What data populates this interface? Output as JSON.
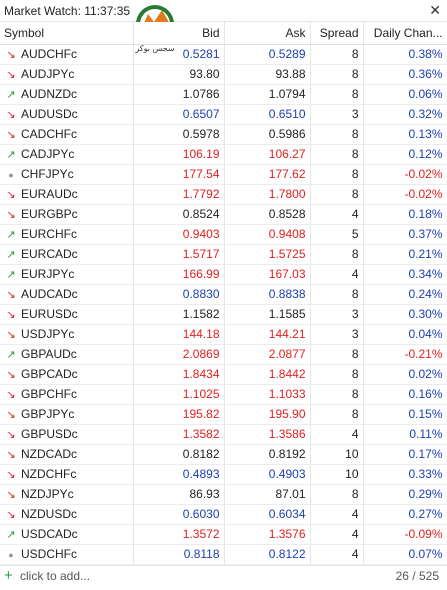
{
  "window": {
    "title": "Market Watch: 11:37:35",
    "close_glyph": "✕"
  },
  "logo": {
    "text": "سجس بوکر",
    "icon": "fox-logo-icon"
  },
  "columns": {
    "symbol": "Symbol",
    "bid": "Bid",
    "ask": "Ask",
    "spread": "Spread",
    "change": "Daily Chan..."
  },
  "colors": {
    "down": "#d43030",
    "up": "#2a9a3a",
    "bid_blue": "#1a3fb0",
    "price_red": "#e02020"
  },
  "rows": [
    {
      "symbol": "AUDCHFc",
      "dir": "down",
      "bid": "0.5281",
      "ask": "0.5289",
      "price_color": "blue",
      "spread": "8",
      "change": "0.38%",
      "change_color": "blue"
    },
    {
      "symbol": "AUDJPYc",
      "dir": "down",
      "bid": "93.80",
      "ask": "93.88",
      "price_color": "black",
      "spread": "8",
      "change": "0.36%",
      "change_color": "blue"
    },
    {
      "symbol": "AUDNZDc",
      "dir": "up",
      "bid": "1.0786",
      "ask": "1.0794",
      "price_color": "black",
      "spread": "8",
      "change": "0.06%",
      "change_color": "blue"
    },
    {
      "symbol": "AUDUSDc",
      "dir": "down",
      "bid": "0.6507",
      "ask": "0.6510",
      "price_color": "blue",
      "spread": "3",
      "change": "0.32%",
      "change_color": "blue"
    },
    {
      "symbol": "CADCHFc",
      "dir": "down",
      "bid": "0.5978",
      "ask": "0.5986",
      "price_color": "black",
      "spread": "8",
      "change": "0.13%",
      "change_color": "blue"
    },
    {
      "symbol": "CADJPYc",
      "dir": "up",
      "bid": "106.19",
      "ask": "106.27",
      "price_color": "red",
      "spread": "8",
      "change": "0.12%",
      "change_color": "blue"
    },
    {
      "symbol": "CHFJPYc",
      "dir": "flat",
      "bid": "177.54",
      "ask": "177.62",
      "price_color": "red",
      "spread": "8",
      "change": "-0.02%",
      "change_color": "red"
    },
    {
      "symbol": "EURAUDc",
      "dir": "down",
      "bid": "1.7792",
      "ask": "1.7800",
      "price_color": "red",
      "spread": "8",
      "change": "-0.02%",
      "change_color": "red"
    },
    {
      "symbol": "EURGBPc",
      "dir": "down",
      "bid": "0.8524",
      "ask": "0.8528",
      "price_color": "black",
      "spread": "4",
      "change": "0.18%",
      "change_color": "blue"
    },
    {
      "symbol": "EURCHFc",
      "dir": "up",
      "bid": "0.9403",
      "ask": "0.9408",
      "price_color": "red",
      "spread": "5",
      "change": "0.37%",
      "change_color": "blue"
    },
    {
      "symbol": "EURCADc",
      "dir": "up",
      "bid": "1.5717",
      "ask": "1.5725",
      "price_color": "red",
      "spread": "8",
      "change": "0.21%",
      "change_color": "blue"
    },
    {
      "symbol": "EURJPYc",
      "dir": "up",
      "bid": "166.99",
      "ask": "167.03",
      "price_color": "red",
      "spread": "4",
      "change": "0.34%",
      "change_color": "blue"
    },
    {
      "symbol": "AUDCADc",
      "dir": "down",
      "bid": "0.8830",
      "ask": "0.8838",
      "price_color": "blue",
      "spread": "8",
      "change": "0.24%",
      "change_color": "blue"
    },
    {
      "symbol": "EURUSDc",
      "dir": "down",
      "bid": "1.1582",
      "ask": "1.1585",
      "price_color": "black",
      "spread": "3",
      "change": "0.30%",
      "change_color": "blue"
    },
    {
      "symbol": "USDJPYc",
      "dir": "down",
      "bid": "144.18",
      "ask": "144.21",
      "price_color": "red",
      "spread": "3",
      "change": "0.04%",
      "change_color": "blue"
    },
    {
      "symbol": "GBPAUDc",
      "dir": "up",
      "bid": "2.0869",
      "ask": "2.0877",
      "price_color": "red",
      "spread": "8",
      "change": "-0.21%",
      "change_color": "red"
    },
    {
      "symbol": "GBPCADc",
      "dir": "down",
      "bid": "1.8434",
      "ask": "1.8442",
      "price_color": "red",
      "spread": "8",
      "change": "0.02%",
      "change_color": "blue"
    },
    {
      "symbol": "GBPCHFc",
      "dir": "down",
      "bid": "1.1025",
      "ask": "1.1033",
      "price_color": "red",
      "spread": "8",
      "change": "0.16%",
      "change_color": "blue"
    },
    {
      "symbol": "GBPJPYc",
      "dir": "down",
      "bid": "195.82",
      "ask": "195.90",
      "price_color": "red",
      "spread": "8",
      "change": "0.15%",
      "change_color": "blue"
    },
    {
      "symbol": "GBPUSDc",
      "dir": "down",
      "bid": "1.3582",
      "ask": "1.3586",
      "price_color": "red",
      "spread": "4",
      "change": "0.11%",
      "change_color": "blue"
    },
    {
      "symbol": "NZDCADc",
      "dir": "down",
      "bid": "0.8182",
      "ask": "0.8192",
      "price_color": "black",
      "spread": "10",
      "change": "0.17%",
      "change_color": "blue"
    },
    {
      "symbol": "NZDCHFc",
      "dir": "down",
      "bid": "0.4893",
      "ask": "0.4903",
      "price_color": "blue",
      "spread": "10",
      "change": "0.33%",
      "change_color": "blue"
    },
    {
      "symbol": "NZDJPYc",
      "dir": "down",
      "bid": "86.93",
      "ask": "87.01",
      "price_color": "black",
      "spread": "8",
      "change": "0.29%",
      "change_color": "blue"
    },
    {
      "symbol": "NZDUSDc",
      "dir": "down",
      "bid": "0.6030",
      "ask": "0.6034",
      "price_color": "blue",
      "spread": "4",
      "change": "0.27%",
      "change_color": "blue"
    },
    {
      "symbol": "USDCADc",
      "dir": "up",
      "bid": "1.3572",
      "ask": "1.3576",
      "price_color": "red",
      "spread": "4",
      "change": "-0.09%",
      "change_color": "red"
    },
    {
      "symbol": "USDCHFc",
      "dir": "flat",
      "bid": "0.8118",
      "ask": "0.8122",
      "price_color": "blue",
      "spread": "4",
      "change": "0.07%",
      "change_color": "blue"
    }
  ],
  "footer": {
    "plus_glyph": "+",
    "add_label": "click to add...",
    "count": "26 / 525"
  }
}
